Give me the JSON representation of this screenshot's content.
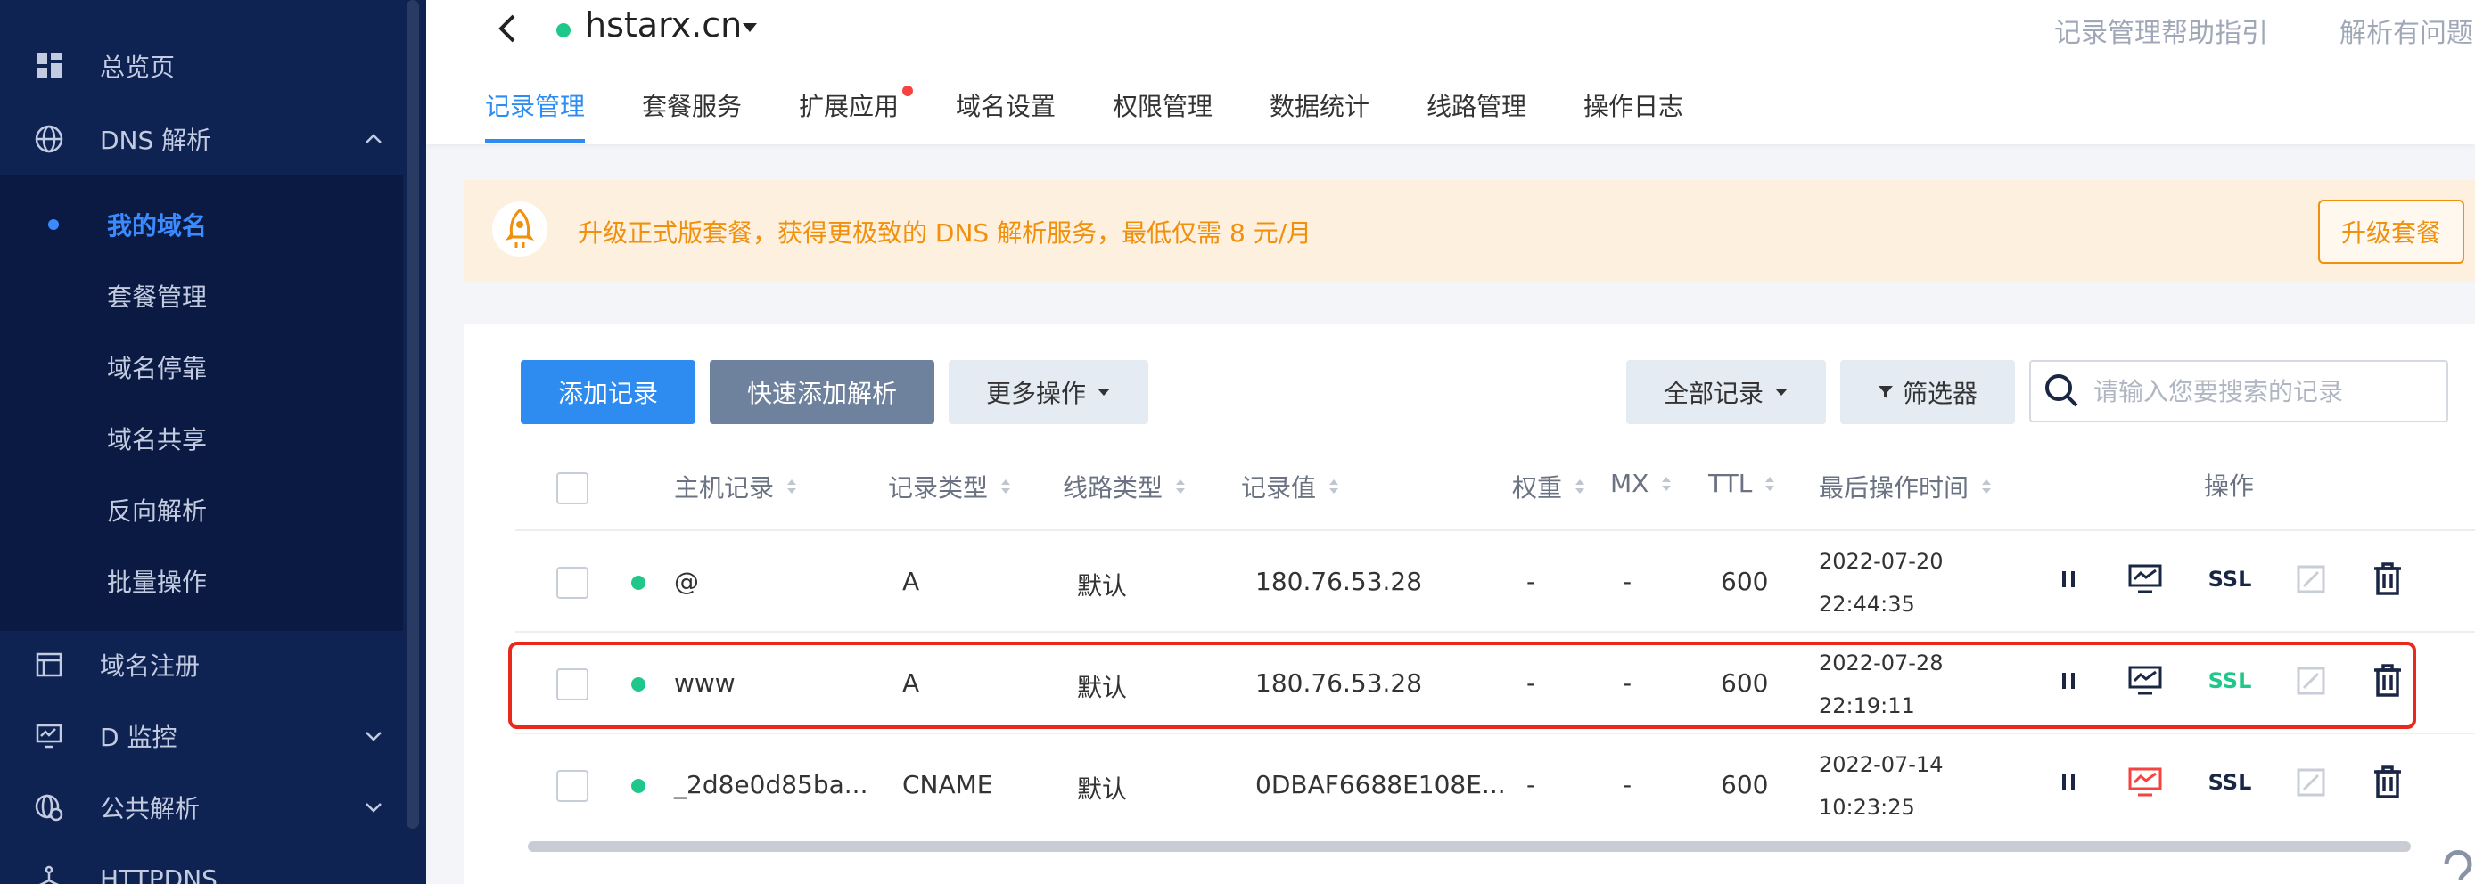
{
  "sidebar": {
    "items": [
      {
        "label": "总览页",
        "icon": "dashboard-icon"
      },
      {
        "label": "DNS 解析",
        "icon": "globe-icon"
      },
      {
        "label": "域名注册",
        "icon": "register-icon"
      },
      {
        "label": "D 监控",
        "icon": "monitor-icon"
      },
      {
        "label": "公共解析",
        "icon": "public-dns-icon"
      },
      {
        "label": "HTTPDNS",
        "icon": "network-icon"
      }
    ],
    "sub_items": [
      {
        "label": "我的域名"
      },
      {
        "label": "套餐管理"
      },
      {
        "label": "域名停靠"
      },
      {
        "label": "域名共享"
      },
      {
        "label": "反向解析"
      },
      {
        "label": "批量操作"
      }
    ]
  },
  "header": {
    "domain": "hstarx.cn",
    "links": [
      "记录管理帮助指引",
      "解析有问题"
    ],
    "tabs": [
      "记录管理",
      "套餐服务",
      "扩展应用",
      "域名设置",
      "权限管理",
      "数据统计",
      "线路管理",
      "操作日志"
    ]
  },
  "banner": {
    "text": "升级正式版套餐，获得更极致的 DNS 解析服务，最低仅需 8 元/月",
    "button": "升级套餐"
  },
  "toolbar": {
    "add": "添加记录",
    "quick_add": "快速添加解析",
    "more": "更多操作",
    "all_records": "全部记录",
    "filter": "筛选器",
    "search_placeholder": "请输入您要搜索的记录"
  },
  "table": {
    "headers": [
      "主机记录",
      "记录类型",
      "线路类型",
      "记录值",
      "权重",
      "MX",
      "TTL",
      "最后操作时间",
      "操作"
    ],
    "rows": [
      {
        "host": "@",
        "type": "A",
        "line": "默认",
        "value": "180.76.53.28",
        "weight": "-",
        "mx": "-",
        "ttl": "600",
        "date": "2022-07-20",
        "time": "22:44:35",
        "ssl": "SSL"
      },
      {
        "host": "www",
        "type": "A",
        "line": "默认",
        "value": "180.76.53.28",
        "weight": "-",
        "mx": "-",
        "ttl": "600",
        "date": "2022-07-28",
        "time": "22:19:11",
        "ssl": "SSL"
      },
      {
        "host": "_2d8e0d85ba...",
        "type": "CNAME",
        "line": "默认",
        "value": "0DBAF6688E108E...",
        "weight": "-",
        "mx": "-",
        "ttl": "600",
        "date": "2022-07-14",
        "time": "10:23:25",
        "ssl": "SSL"
      }
    ]
  },
  "colors": {
    "sidebar_bg": "#0f2353",
    "primary": "#2e8cf0",
    "success": "#1fc88a",
    "warning": "#f0900c",
    "danger": "#e8291c"
  }
}
